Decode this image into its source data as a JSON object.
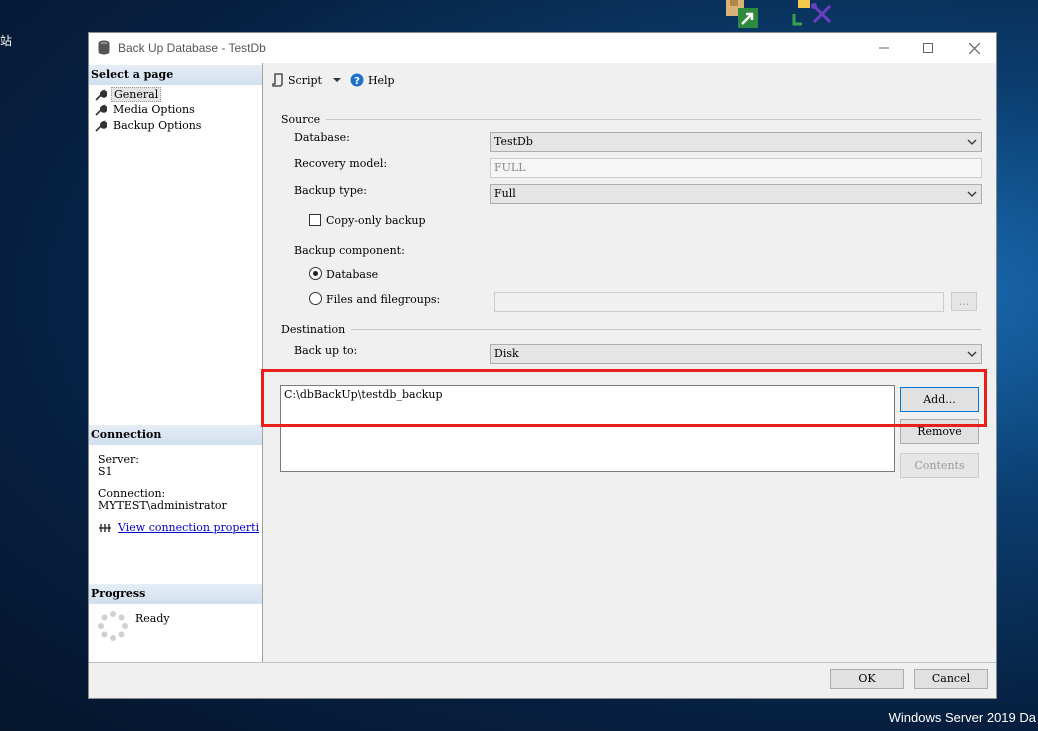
{
  "desktop": {
    "left_text": "站",
    "os_watermark": "Windows Server 2019 Da"
  },
  "window": {
    "title": "Back Up Database - TestDb"
  },
  "left": {
    "select_page_header": "Select a page",
    "pages": [
      {
        "label": "General",
        "selected": true
      },
      {
        "label": "Media Options",
        "selected": false
      },
      {
        "label": "Backup Options",
        "selected": false
      }
    ],
    "connection_header": "Connection",
    "server_label": "Server:",
    "server_value": "S1",
    "connection_label": "Connection:",
    "connection_value": "MYTEST\\administrator",
    "view_link": "View connection properti",
    "progress_header": "Progress",
    "progress_status": "Ready"
  },
  "toolbar": {
    "script_label": "Script",
    "help_label": "Help"
  },
  "source": {
    "group_label": "Source",
    "database_label": "Database:",
    "database_value": "TestDb",
    "recovery_label": "Recovery model:",
    "recovery_value": "FULL",
    "backup_type_label": "Backup type:",
    "backup_type_value": "Full",
    "copy_only_label": "Copy-only backup",
    "component_label": "Backup component:",
    "radio_database": "Database",
    "radio_files": "Files and filegroups:",
    "ellipsis": "..."
  },
  "destination": {
    "group_label": "Destination",
    "backup_to_label": "Back up to:",
    "backup_to_value": "Disk",
    "paths": [
      "C:\\dbBackUp\\testdb_backup"
    ],
    "add_label": "Add...",
    "remove_label": "Remove",
    "contents_label": "Contents"
  },
  "footer": {
    "ok_label": "OK",
    "cancel_label": "Cancel"
  },
  "colors": {
    "highlight": "#e8201b",
    "accent": "#0078d7"
  }
}
